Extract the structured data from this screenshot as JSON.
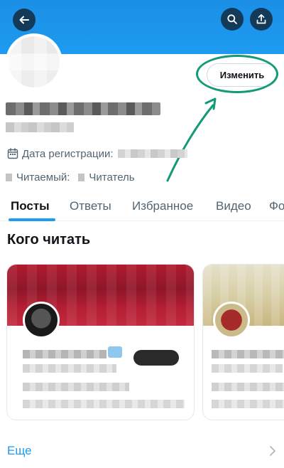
{
  "header": {
    "back_icon": "arrow-left-icon",
    "search_icon": "search-icon",
    "share_icon": "share-icon"
  },
  "profile": {
    "edit_button_label": "Изменить",
    "join_label": "Дата регистрации:",
    "following_label": "Читаемый:",
    "followers_label": "Читатель"
  },
  "tabs": [
    {
      "label": "Посты",
      "active": true
    },
    {
      "label": "Ответы",
      "active": false
    },
    {
      "label": "Избранное",
      "active": false
    },
    {
      "label": "Видео",
      "active": false
    },
    {
      "label": "Фото",
      "active": false
    }
  ],
  "who_to_follow": {
    "title": "Кого читать",
    "more_label": "Еще"
  },
  "colors": {
    "accent": "#1d9bf0",
    "annotation": "#159a77",
    "header_button": "#143a5a"
  }
}
